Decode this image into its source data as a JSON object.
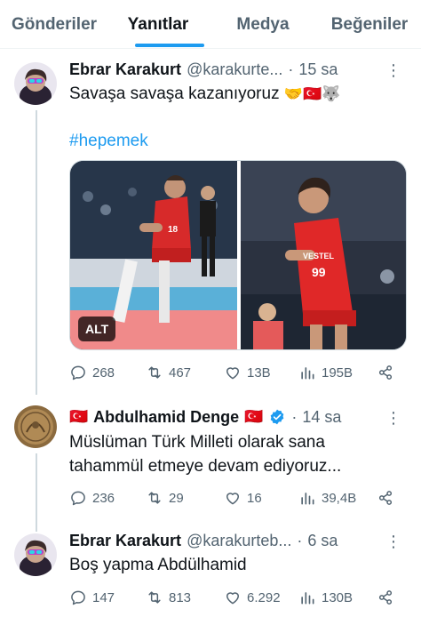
{
  "tabs": [
    {
      "label": "Gönderiler",
      "active": false
    },
    {
      "label": "Yanıtlar",
      "active": true
    },
    {
      "label": "Medya",
      "active": false
    },
    {
      "label": "Beğeniler",
      "active": false
    }
  ],
  "posts": [
    {
      "name": "Ebrar Karakurt",
      "handle": "@karakurte...",
      "time": "15 sa",
      "text": "Savaşa savaşa kazanıyoruz",
      "emojis": "🤝🇹🇷🐺",
      "hashtag": "#hepemek",
      "alt_label": "ALT",
      "stats": {
        "replies": "268",
        "reposts": "467",
        "likes": "13B",
        "views": "195B"
      }
    },
    {
      "name": "Abdulhamid Denge",
      "flag": "🇹🇷",
      "handle": "",
      "time": "14 sa",
      "text_line1": "Müslüman Türk Milleti olarak sana",
      "text_line2": "tahammül etmeye devam ediyoruz...",
      "stats": {
        "replies": "236",
        "reposts": "29",
        "likes": "16",
        "views": "39,4B"
      }
    },
    {
      "name": "Ebrar Karakurt",
      "handle": "@karakurteb...",
      "time": "6 sa",
      "text": "Boş yapma Abdülhamid",
      "stats": {
        "replies": "147",
        "reposts": "813",
        "likes": "6.292",
        "views": "130B"
      }
    }
  ],
  "colors": {
    "accent": "#1d9bf0",
    "secondary_text": "#536471",
    "verified": "#1d9bf0",
    "divider": "#eff3f4"
  }
}
